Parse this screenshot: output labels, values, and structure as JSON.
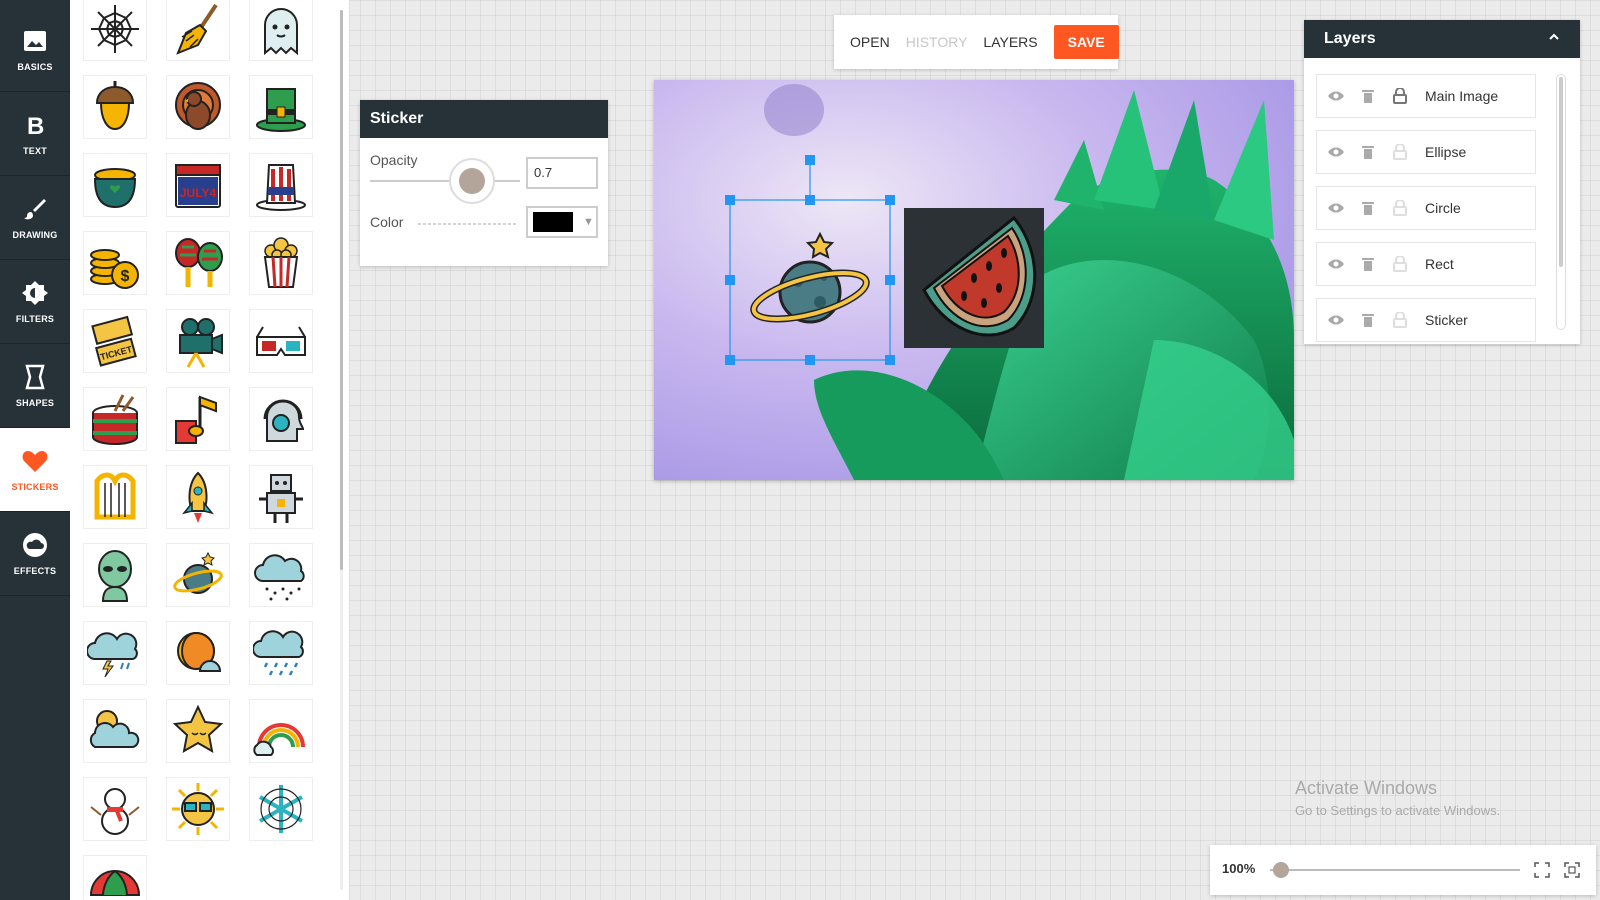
{
  "nav": {
    "items": [
      {
        "label": "BASICS",
        "icon": "image-icon"
      },
      {
        "label": "TEXT",
        "icon": "bold-icon"
      },
      {
        "label": "DRAWING",
        "icon": "brush-icon"
      },
      {
        "label": "FILTERS",
        "icon": "filter-icon"
      },
      {
        "label": "SHAPES",
        "icon": "shape-icon"
      },
      {
        "label": "STICKERS",
        "icon": "heart-icon"
      },
      {
        "label": "EFFECTS",
        "icon": "cloud-icon"
      }
    ],
    "active_index": 5,
    "active_color": "#ff5722"
  },
  "stickers": {
    "icons": [
      "spider-web-icon",
      "broom-icon",
      "ghost-icon",
      "acorn-icon",
      "turkey-icon",
      "leprechaun-hat-icon",
      "pot-of-gold-icon",
      "july-4-calendar-icon",
      "uncle-sam-hat-icon",
      "coins-icon",
      "maracas-icon",
      "popcorn-icon",
      "tickets-icon",
      "movie-camera-icon",
      "3d-glasses-icon",
      "drum-icon",
      "music-note-icon",
      "headphones-head-icon",
      "harp-icon",
      "rocket-icon",
      "robot-icon",
      "alien-icon",
      "planet-icon",
      "snow-cloud-icon",
      "storm-cloud-icon",
      "moon-sun-icon",
      "rain-cloud-icon",
      "sun-cloud-icon",
      "star-icon",
      "rainbow-icon",
      "snowman-icon",
      "sun-sunglasses-icon",
      "snowflake-icon",
      "umbrella-icon"
    ],
    "july4_text": "JULY4",
    "tickets_text": "TICKET"
  },
  "toolbar": {
    "open": "OPEN",
    "history": "HISTORY",
    "layers": "LAYERS",
    "save": "SAVE",
    "save_color": "#ff5722"
  },
  "sticker_panel": {
    "title": "Sticker",
    "opacity_label": "Opacity",
    "opacity_value": "0.7",
    "color_label": "Color",
    "color_value": "#000000"
  },
  "layers_panel": {
    "title": "Layers",
    "items": [
      "Main Image",
      "Ellipse",
      "Circle",
      "Rect",
      "Sticker"
    ]
  },
  "zoom": {
    "label": "100%"
  },
  "watermark": {
    "title": "Activate Windows",
    "subtitle": "Go to Settings to activate Windows."
  },
  "colors": {
    "dark": "#263238",
    "accent": "#ff5722",
    "selection": "#2196f3"
  }
}
